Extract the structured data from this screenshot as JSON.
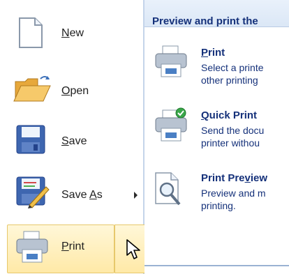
{
  "menu": {
    "items": [
      {
        "label_pre": "",
        "label_u": "N",
        "label_post": "ew"
      },
      {
        "label_pre": "",
        "label_u": "O",
        "label_post": "pen"
      },
      {
        "label_pre": "",
        "label_u": "S",
        "label_post": "ave"
      },
      {
        "label_pre": "Save ",
        "label_u": "A",
        "label_post": "s"
      },
      {
        "label_pre": "",
        "label_u": "P",
        "label_post": "rint"
      }
    ]
  },
  "right": {
    "header": "Preview and print the",
    "items": [
      {
        "title_pre": "",
        "title_u": "P",
        "title_post": "rint",
        "desc": [
          "Select a printe",
          "other printing"
        ]
      },
      {
        "title_pre": "",
        "title_u": "Q",
        "title_post": "uick Print",
        "desc": [
          "Send the docu",
          "printer withou"
        ]
      },
      {
        "title_pre": "Print Pre",
        "title_u": "v",
        "title_post": "iew",
        "desc": [
          "Preview and m",
          "printing."
        ]
      }
    ]
  },
  "icons": [
    "new-document-icon",
    "open-folder-icon",
    "save-disk-icon",
    "save-as-icon",
    "printer-icon",
    "quick-print-icon",
    "print-preview-icon",
    "mouse-cursor-icon"
  ]
}
